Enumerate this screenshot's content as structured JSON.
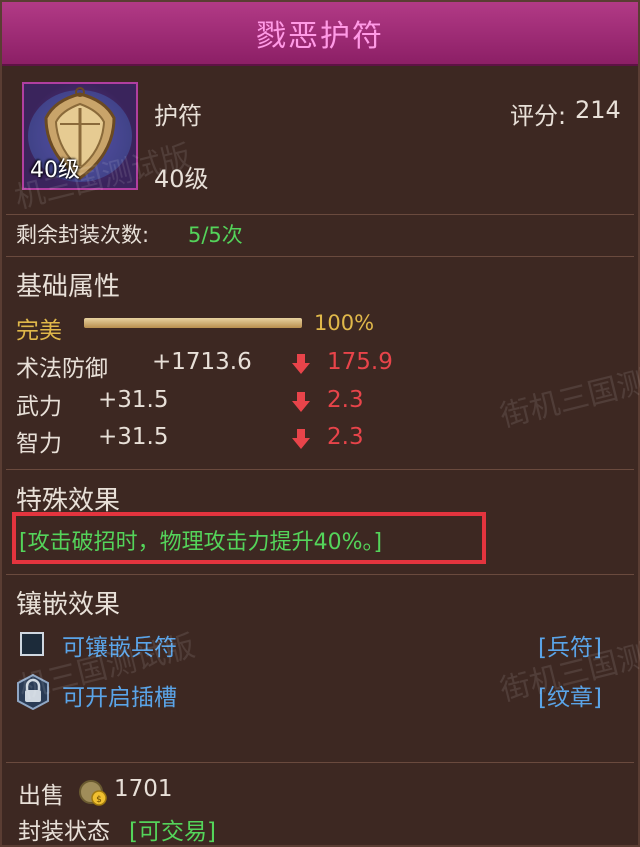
{
  "item": {
    "name": "戮恶护符",
    "type": "护符",
    "level": "40级",
    "icon_level": "40级",
    "score_label": "评分:",
    "score": "214",
    "seal_label": "剩余封装次数:",
    "seal_value": "5/5次"
  },
  "base": {
    "heading": "基础属性",
    "quality_label": "完美",
    "quality_percent": "100%",
    "quality_fraction": 1.0,
    "stats": [
      {
        "name": "术法防御",
        "value": "+1713.6",
        "diff": "175.9"
      },
      {
        "name": "武力",
        "value": "+31.5",
        "diff": "2.3"
      },
      {
        "name": "智力",
        "value": "+31.5",
        "diff": "2.3"
      }
    ]
  },
  "special": {
    "heading": "特殊效果",
    "text": "[攻击破招时，物理攻击力提升40%。]"
  },
  "inlay": {
    "heading": "镶嵌效果",
    "slot1_label": "可镶嵌兵符",
    "slot1_tag": "[兵符]",
    "slot2_label": "可开启插槽",
    "slot2_tag": "[纹章]"
  },
  "footer": {
    "sell_label": "出售",
    "sell_price": "1701",
    "seal_state_label": "封装状态",
    "seal_state_value": "[可交易]"
  },
  "watermarks": [
    "机三国测试版",
    "街机三国测",
    "机三国测试版",
    "街机三国测"
  ],
  "colors": {
    "title": "#ff9ae6",
    "green": "#54d45a",
    "red": "#e8444a",
    "gold": "#e0b84a",
    "blue": "#5aa4e8"
  },
  "icons": [
    "shield-amulet-icon",
    "down-arrow-icon",
    "lock-icon",
    "coin-bag-icon",
    "checkbox-icon"
  ]
}
